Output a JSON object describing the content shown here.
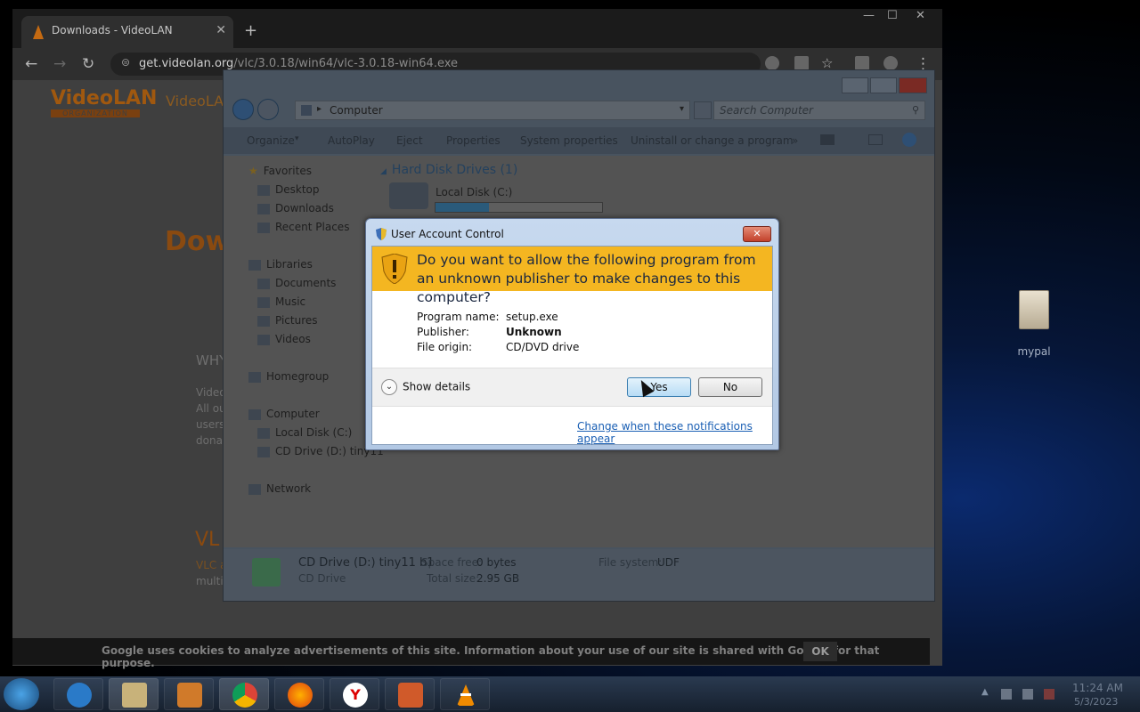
{
  "desktop": {
    "icon_label": "mypal"
  },
  "browser": {
    "tab_title": "Downloads - VideoLAN",
    "url_host": "get.videolan.org",
    "url_path": "/vlc/3.0.18/win64/vlc-3.0.18-win64.exe"
  },
  "page": {
    "logo_text": "VideoLAN",
    "logo_sub": "ORGANIZATION",
    "heading_partial": "Dow",
    "site_name_partial": "VideoLA",
    "why_partial": "WHY",
    "para_partial": [
      "Video",
      "All ou",
      "users",
      "donat"
    ],
    "vlc_partial": "VL",
    "vlc_sub_partial": [
      "VLC a",
      "multi"
    ],
    "cookie_msg": "Google uses cookies to analyze advertisements of this site. Information about your use of our site is shared with Google for that purpose.",
    "cookie_ok": "OK"
  },
  "explorer": {
    "address": "Computer",
    "search_placeholder": "Search Computer",
    "commands": [
      "Organize",
      "AutoPlay",
      "Eject",
      "Properties",
      "System properties",
      "Uninstall or change a program"
    ],
    "nav": {
      "favorites": "Favorites",
      "desktop": "Desktop",
      "downloads": "Downloads",
      "recent": "Recent Places",
      "libraries": "Libraries",
      "documents": "Documents",
      "music": "Music",
      "pictures": "Pictures",
      "videos": "Videos",
      "homegroup": "Homegroup",
      "computer": "Computer",
      "local_disk": "Local Disk (C:)",
      "cd_drive": "CD Drive (D:) tiny11",
      "network": "Network"
    },
    "section_title": "Hard Disk Drives (1)",
    "drive_name": "Local Disk (C:)",
    "drive_fill": 0.32,
    "status": {
      "name": "CD Drive (D:) tiny11 b1",
      "type": "CD Drive",
      "space_free_label": "Space free:",
      "space_free": "0 bytes",
      "total_label": "Total size:",
      "total": "2.95 GB",
      "fs_label": "File system:",
      "fs": "UDF"
    }
  },
  "uac": {
    "title": "User Account Control",
    "close": "✕",
    "question": "Do you want to allow the following program from an unknown publisher to make changes to this computer?",
    "program_label": "Program name:",
    "program_value": "setup.exe",
    "publisher_label": "Publisher:",
    "publisher_value": "Unknown",
    "origin_label": "File origin:",
    "origin_value": "CD/DVD drive",
    "show_details": "Show details",
    "yes": "Yes",
    "no": "No",
    "link": "Change when these notifications appear"
  },
  "taskbar": {
    "time": "11:24 AM",
    "date": "5/3/2023"
  }
}
